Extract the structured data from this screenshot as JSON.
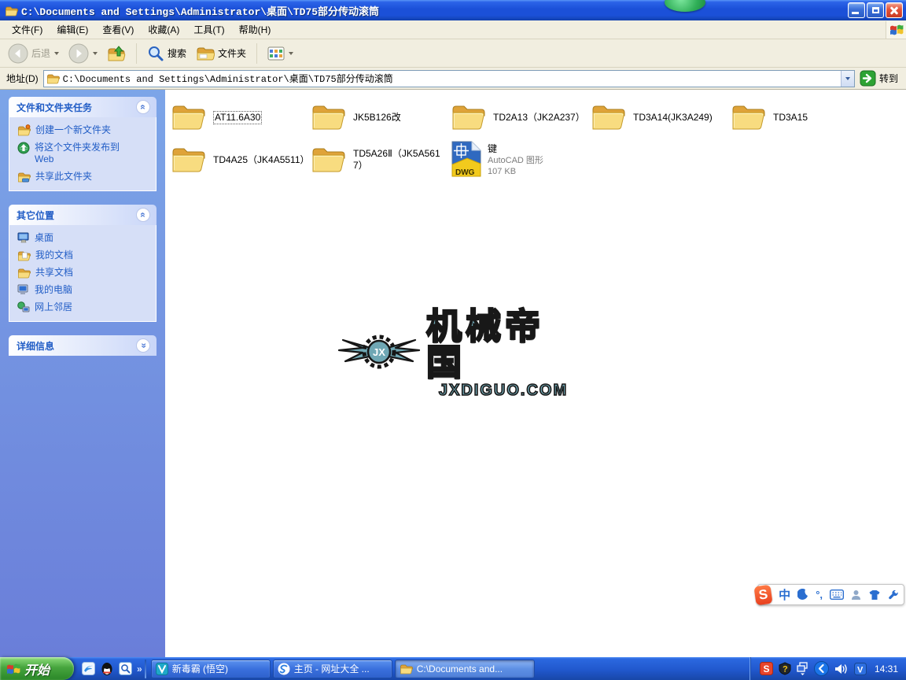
{
  "window": {
    "title": "C:\\Documents and Settings\\Administrator\\桌面\\TD75部分传动滚筒"
  },
  "menu": {
    "items": [
      "文件(F)",
      "编辑(E)",
      "查看(V)",
      "收藏(A)",
      "工具(T)",
      "帮助(H)"
    ]
  },
  "toolbar": {
    "back": "后退",
    "search": "搜索",
    "folders": "文件夹"
  },
  "address": {
    "label": "地址(D)",
    "value": "C:\\Documents and Settings\\Administrator\\桌面\\TD75部分传动滚筒",
    "go": "转到"
  },
  "sidebar": {
    "panes": [
      {
        "id": "file-tasks",
        "title": "文件和文件夹任务",
        "collapsed": false,
        "items": [
          {
            "icon": "new-folder-icon",
            "label": "创建一个新文件夹"
          },
          {
            "icon": "publish-web-icon",
            "label": "将这个文件夹发布到 Web"
          },
          {
            "icon": "share-folder-icon",
            "label": "共享此文件夹"
          }
        ]
      },
      {
        "id": "other-places",
        "title": "其它位置",
        "collapsed": false,
        "items": [
          {
            "icon": "desktop-icon",
            "label": "桌面"
          },
          {
            "icon": "my-documents-icon",
            "label": "我的文档"
          },
          {
            "icon": "shared-documents-icon",
            "label": "共享文档"
          },
          {
            "icon": "my-computer-icon",
            "label": "我的电脑"
          },
          {
            "icon": "network-places-icon",
            "label": "网上邻居"
          }
        ]
      },
      {
        "id": "details",
        "title": "详细信息",
        "collapsed": true,
        "items": []
      }
    ]
  },
  "files": [
    {
      "name": "AT11.6A30",
      "type": "folder",
      "selected": true
    },
    {
      "name": "JK5B126改",
      "type": "folder"
    },
    {
      "name": "TD2A13（JK2A237）",
      "type": "folder"
    },
    {
      "name": "TD3A14(JK3A249)",
      "type": "folder"
    },
    {
      "name": "TD3A15",
      "type": "folder"
    },
    {
      "name": "TD4A25（JK4A5511）",
      "type": "folder"
    },
    {
      "name": "TD5A26Ⅱ（JK5A5617）",
      "type": "folder"
    },
    {
      "name": "键",
      "type": "dwg",
      "file_type": "AutoCAD 图形",
      "size": "107 KB",
      "badge": "DWG"
    }
  ],
  "watermark": {
    "title": "机械帝国",
    "url": "JXDIGUO.COM",
    "logo": "JX"
  },
  "ime": {
    "brand": "S",
    "mode": "中",
    "punct": "°,",
    "icons": [
      "moon-icon",
      "keyboard-icon",
      "person-icon",
      "skin-icon",
      "wrench-icon"
    ]
  },
  "taskbar": {
    "start": "开始",
    "quick_launch": [
      "sogou-browser-icon",
      "qq-icon",
      "quick-search-icon"
    ],
    "quick_chevron": "»",
    "tasks": [
      {
        "icon": "duba-icon",
        "label": "新毒霸 (悟空)",
        "active": false
      },
      {
        "icon": "sogou-page-icon",
        "label": "主页 - 网址大全 ...",
        "active": false
      },
      {
        "icon": "small-folder-icon",
        "label": "C:\\Documents and...",
        "active": true
      }
    ],
    "tray": {
      "icons": [
        "sogou-s-icon",
        "help-icon",
        "window-switch-icon",
        "back-circle-icon",
        "volume-icon",
        "v-check-icon"
      ],
      "time": "14:31"
    }
  },
  "glyphs": {
    "sogou_s": "S",
    "help": "?",
    "v_check": "V",
    "chevron": "«"
  }
}
